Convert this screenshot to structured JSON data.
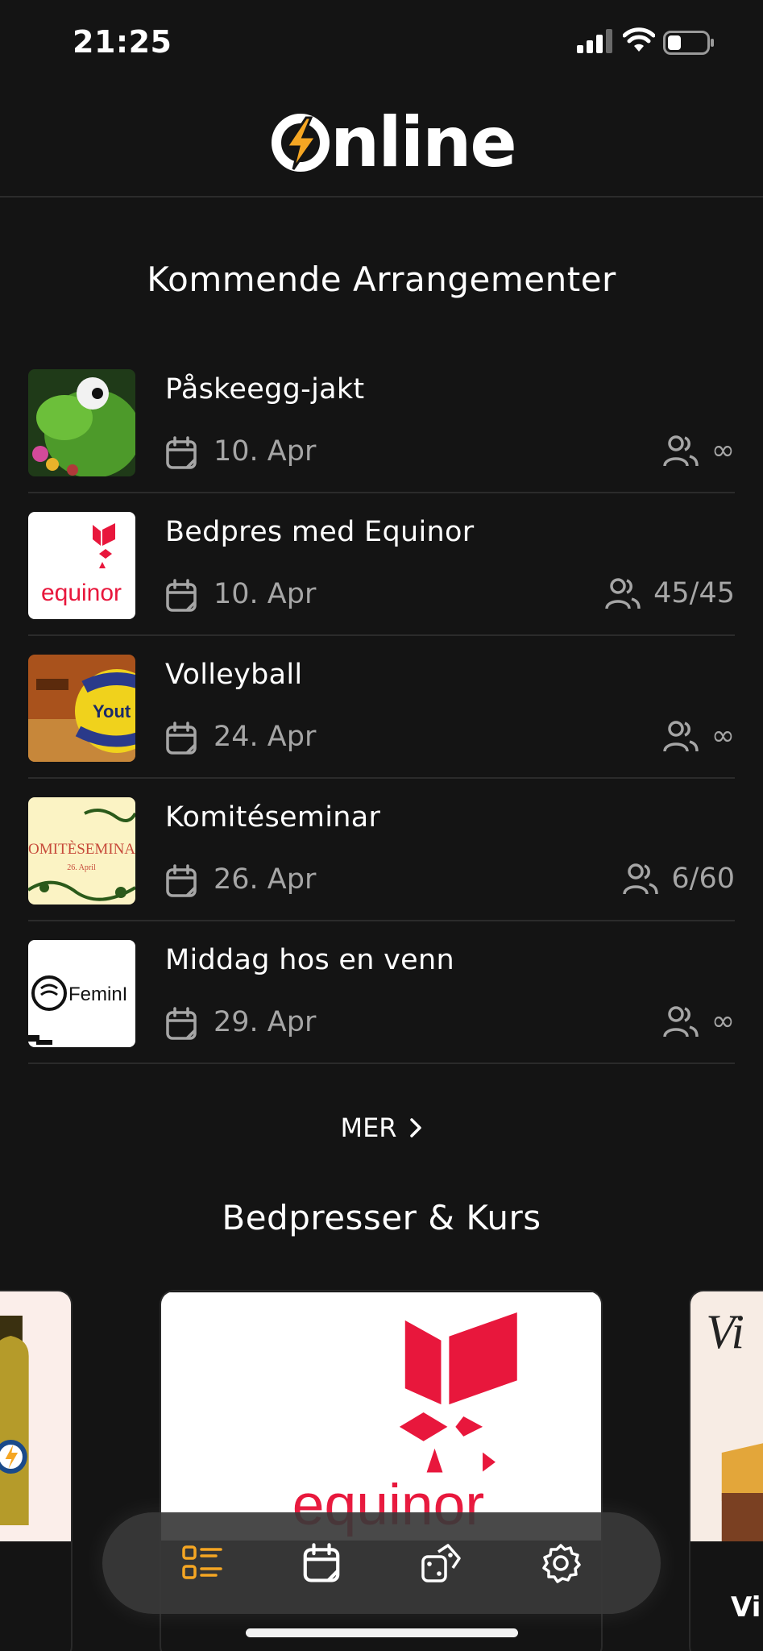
{
  "status_bar": {
    "time": "21:25"
  },
  "app": {
    "logo_text": "nline",
    "brand_color": "#f5a623"
  },
  "sections": {
    "upcoming_title": "Kommende Arrangementer",
    "courses_title": "Bedpresser & Kurs"
  },
  "events": [
    {
      "title": "Påskeegg-jakt",
      "date": "10. Apr",
      "attendance": "∞",
      "thumb": "frog"
    },
    {
      "title": "Bedpres med Equinor",
      "date": "10. Apr",
      "attendance": "45/45",
      "thumb": "equinor"
    },
    {
      "title": "Volleyball",
      "date": "24. Apr",
      "attendance": "∞",
      "thumb": "volleyball"
    },
    {
      "title": "Komitéseminar",
      "date": "26. Apr",
      "attendance": "6/60",
      "thumb": "komiteseminar"
    },
    {
      "title": "Middag hos en venn",
      "date": "29. Apr",
      "attendance": "∞",
      "thumb": "feminit"
    }
  ],
  "more_label": "MER",
  "carousel": {
    "center_logo_text": "equinor",
    "right_label": "Vi"
  },
  "nav": [
    "list-icon",
    "calendar-icon",
    "dice-icon",
    "settings-icon"
  ]
}
